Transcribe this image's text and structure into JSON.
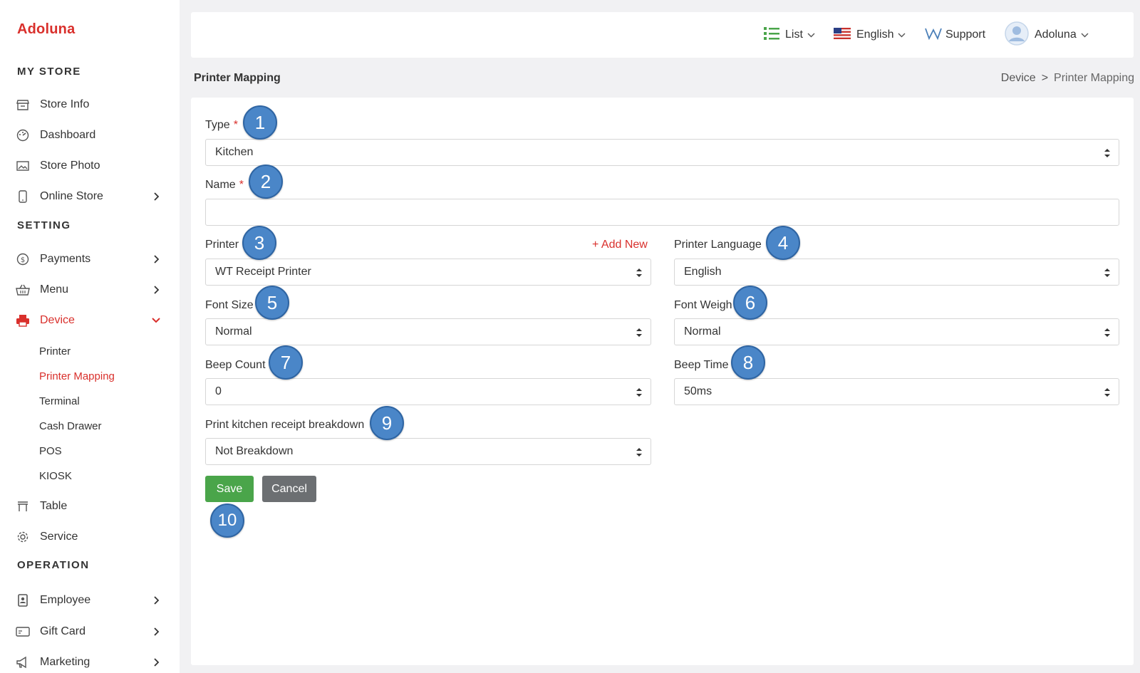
{
  "app": {
    "brand": "Adoluna"
  },
  "sidebar": {
    "sections": [
      "MY STORE",
      "SETTING",
      "OPERATION"
    ],
    "items": [
      {
        "label": "Store Info",
        "icon": "store-icon"
      },
      {
        "label": "Dashboard",
        "icon": "dashboard-icon"
      },
      {
        "label": "Store Photo",
        "icon": "photo-icon"
      },
      {
        "label": "Online Store",
        "icon": "mobile-icon"
      },
      {
        "label": "Payments",
        "icon": "dollar-icon"
      },
      {
        "label": "Menu",
        "icon": "basket-icon"
      },
      {
        "label": "Device",
        "icon": "printer-icon"
      },
      {
        "label": "Table",
        "icon": "table-icon"
      },
      {
        "label": "Service",
        "icon": "gear-icon"
      },
      {
        "label": "Employee",
        "icon": "badge-icon"
      },
      {
        "label": "Gift Card",
        "icon": "card-icon"
      },
      {
        "label": "Marketing",
        "icon": "megaphone-icon"
      }
    ],
    "device_sub": [
      "Printer",
      "Printer Mapping",
      "Terminal",
      "Cash Drawer",
      "POS",
      "KIOSK"
    ]
  },
  "topbar": {
    "list_label": "List",
    "language_label": "English",
    "support_label": "Support",
    "user_label": "Adoluna"
  },
  "page": {
    "title": "Printer Mapping",
    "breadcrumb": [
      "Device",
      ">",
      "Printer Mapping"
    ]
  },
  "form": {
    "type_label": "Type",
    "type_value": "Kitchen",
    "required_mark": "*",
    "name_label": "Name",
    "name_value": "",
    "printer_label": "Printer",
    "add_new": "+  Add New",
    "printer_value": "WT Receipt Printer",
    "printer_language_label": "Printer Language",
    "printer_language_value": "English",
    "font_size_label": "Font Size",
    "font_size_value": "Normal",
    "font_weight_label": "Font Weigh",
    "font_weight_value": "Normal",
    "beep_count_label": "Beep Count",
    "beep_count_value": "0",
    "beep_time_label": "Beep Time",
    "beep_time_value": "50ms",
    "breakdown_label": "Print kitchen receipt breakdown",
    "breakdown_value": "Not Breakdown",
    "save_label": "Save",
    "cancel_label": "Cancel"
  },
  "markers": [
    "1",
    "2",
    "3",
    "4",
    "5",
    "6",
    "7",
    "8",
    "9",
    "10"
  ],
  "colors": {
    "brand": "#d9302c",
    "save": "#4aa54a",
    "cancel": "#6c6f72",
    "marker": "#4a86c8"
  }
}
